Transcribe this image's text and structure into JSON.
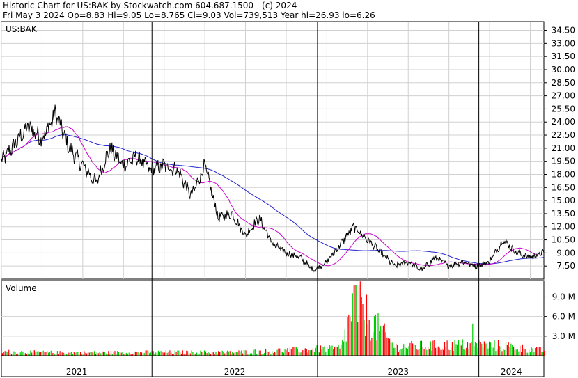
{
  "header": {
    "line1": "Historic Chart for US:BAK by Stockwatch.com 604.687.1500 - (c) 2024",
    "line2": "Fri May  3 2024  Op=8.83  Hi=9.05  Lo=8.765  Cl=9.03  Vol=739,513  Year hi=26.93  lo=6.26"
  },
  "chart_data": [
    {
      "type": "line",
      "symbol": "US:BAK",
      "price_axis_ticks": [
        "34.50",
        "33.00",
        "31.50",
        "30.00",
        "28.50",
        "27.00",
        "25.50",
        "24.00",
        "22.50",
        "21.00",
        "19.50",
        "18.00",
        "16.50",
        "15.00",
        "13.50",
        "12.00",
        "10.50",
        "9.00",
        "7.50"
      ],
      "ylim": [
        6.0,
        35.5
      ],
      "colors": {
        "price": "#000000",
        "ma_short": "#cc00cc",
        "ma_long": "#2222cc",
        "grid": "#d0d0d0"
      },
      "anchors": [
        [
          "2021-01",
          19.5
        ],
        [
          "2021-02",
          21.5
        ],
        [
          "2021-03",
          23.5
        ],
        [
          "2021-04",
          22.0
        ],
        [
          "2021-05",
          25.0
        ],
        [
          "2021-06",
          21.0
        ],
        [
          "2021-07",
          19.0
        ],
        [
          "2021-08",
          17.0
        ],
        [
          "2021-09",
          21.0
        ],
        [
          "2021-10",
          19.0
        ],
        [
          "2021-11",
          20.0
        ],
        [
          "2021-12",
          18.5
        ],
        [
          "2022-01",
          19.0
        ],
        [
          "2022-02",
          18.5
        ],
        [
          "2022-03",
          15.5
        ],
        [
          "2022-04",
          19.0
        ],
        [
          "2022-05",
          13.0
        ],
        [
          "2022-06",
          13.5
        ],
        [
          "2022-07",
          11.0
        ],
        [
          "2022-08",
          13.0
        ],
        [
          "2022-09",
          10.0
        ],
        [
          "2022-10",
          9.0
        ],
        [
          "2022-11",
          8.5
        ],
        [
          "2022-12",
          7.0
        ],
        [
          "2023-01",
          8.0
        ],
        [
          "2023-02",
          10.0
        ],
        [
          "2023-03",
          12.0
        ],
        [
          "2023-04",
          10.5
        ],
        [
          "2023-05",
          9.0
        ],
        [
          "2023-06",
          7.5
        ],
        [
          "2023-07",
          8.0
        ],
        [
          "2023-08",
          7.0
        ],
        [
          "2023-09",
          8.5
        ],
        [
          "2023-10",
          7.5
        ],
        [
          "2023-11",
          8.0
        ],
        [
          "2023-12",
          7.5
        ],
        [
          "2024-01",
          8.0
        ],
        [
          "2024-02",
          10.5
        ],
        [
          "2024-03",
          9.0
        ],
        [
          "2024-04",
          8.5
        ],
        [
          "2024-05",
          9.03
        ]
      ],
      "volume_label": "Volume",
      "volume_axis_ticks": [
        "9.0 M",
        "6.0 M",
        "3.0 M"
      ],
      "volume_ylim": [
        0,
        11.5
      ],
      "volume_colors": {
        "up": "#00cc00",
        "down": "#ff0000"
      },
      "volume_anchors_m": [
        [
          "2021-01",
          0.8
        ],
        [
          "2021-06",
          0.6
        ],
        [
          "2021-12",
          0.7
        ],
        [
          "2022-06",
          0.7
        ],
        [
          "2022-12",
          1.3
        ],
        [
          "2023-02",
          1.5
        ],
        [
          "2023-03",
          10.8
        ],
        [
          "2023-06",
          1.8
        ],
        [
          "2023-11",
          2.2
        ],
        [
          "2024-02",
          2.0
        ],
        [
          "2024-05",
          1.0
        ]
      ],
      "x_labels": [
        "2021",
        "2022",
        "2023",
        "2024"
      ]
    }
  ]
}
